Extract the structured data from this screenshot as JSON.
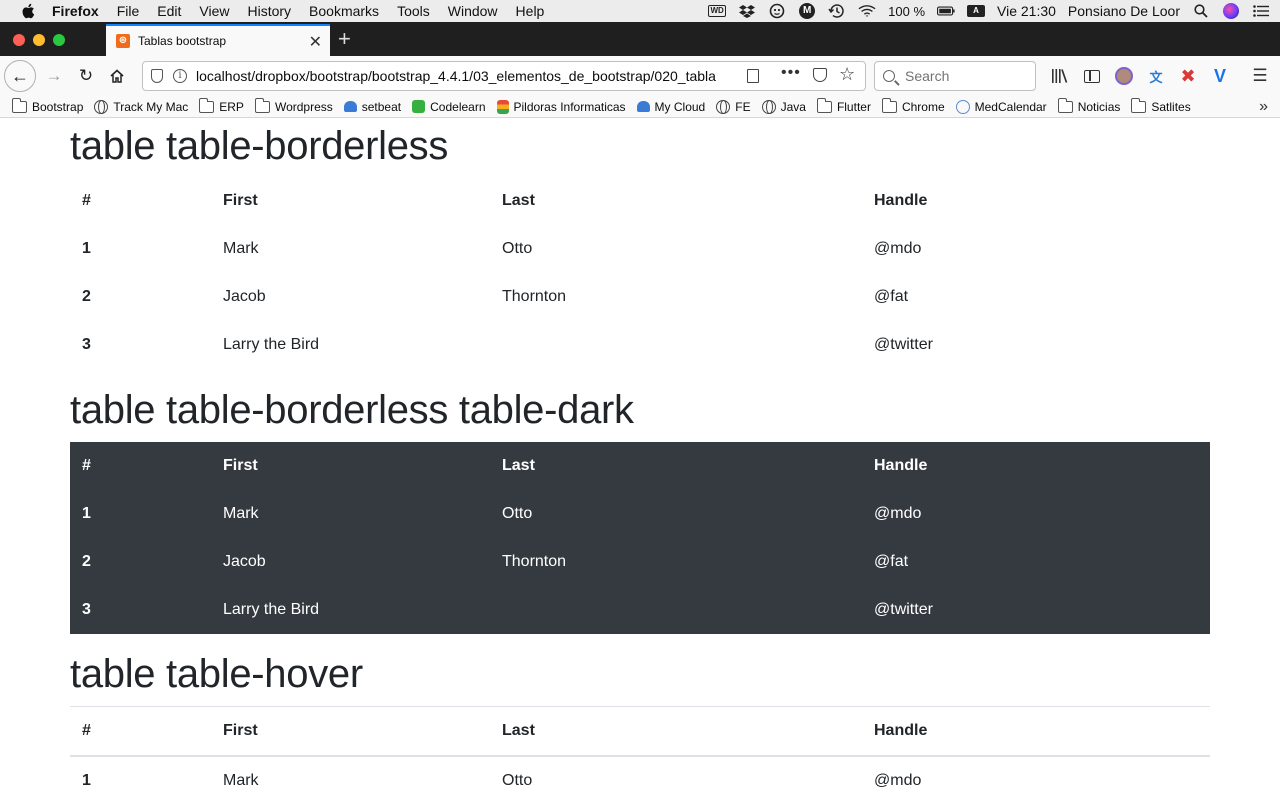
{
  "menubar": {
    "app_name": "Firefox",
    "items": [
      "File",
      "Edit",
      "View",
      "History",
      "Bookmarks",
      "Tools",
      "Window",
      "Help"
    ],
    "battery": "100 %",
    "input_source": "A",
    "clock": "Vie 21:30",
    "user": "Ponsiano De Loor",
    "icons": [
      "wd-icon",
      "dropbox-icon",
      "ghost-icon",
      "m-icon",
      "time-machine-icon",
      "wifi-icon",
      "battery-icon",
      "spotlight-icon",
      "siri-icon",
      "notification-center-icon"
    ]
  },
  "browser": {
    "tab_title": "Tablas bootstrap",
    "url": "localhost/dropbox/bootstrap/bootstrap_4.4.1/03_elementos_de_bootstrap/020_tabla",
    "search_placeholder": "Search",
    "bookmarks": [
      {
        "label": "Bootstrap",
        "icon": "folder"
      },
      {
        "label": "Track My Mac",
        "icon": "globe"
      },
      {
        "label": "ERP",
        "icon": "folder"
      },
      {
        "label": "Wordpress",
        "icon": "folder"
      },
      {
        "label": "setbeat",
        "icon": "blue"
      },
      {
        "label": "Codelearn",
        "icon": "green"
      },
      {
        "label": "Pildoras Informaticas",
        "icon": "stack"
      },
      {
        "label": "My Cloud",
        "icon": "blue"
      },
      {
        "label": "FE",
        "icon": "globe"
      },
      {
        "label": "Java",
        "icon": "globe"
      },
      {
        "label": "Flutter",
        "icon": "folder"
      },
      {
        "label": "Chrome",
        "icon": "folder"
      },
      {
        "label": "MedCalendar",
        "icon": "ui"
      },
      {
        "label": "Noticias",
        "icon": "folder"
      },
      {
        "label": "Satlites",
        "icon": "folder"
      }
    ]
  },
  "page": {
    "sections": [
      {
        "heading": "table table-borderless",
        "headers": [
          "#",
          "First",
          "Last",
          "Handle"
        ],
        "rows": [
          [
            "1",
            "Mark",
            "Otto",
            "@mdo"
          ],
          [
            "2",
            "Jacob",
            "Thornton",
            "@fat"
          ],
          [
            "3",
            "Larry the Bird",
            "",
            "@twitter"
          ]
        ]
      },
      {
        "heading": "table table-borderless table-dark",
        "headers": [
          "#",
          "First",
          "Last",
          "Handle"
        ],
        "rows": [
          [
            "1",
            "Mark",
            "Otto",
            "@mdo"
          ],
          [
            "2",
            "Jacob",
            "Thornton",
            "@fat"
          ],
          [
            "3",
            "Larry the Bird",
            "",
            "@twitter"
          ]
        ]
      },
      {
        "heading": "table table-hover",
        "headers": [
          "#",
          "First",
          "Last",
          "Handle"
        ],
        "rows": [
          [
            "1",
            "Mark",
            "Otto",
            "@mdo"
          ]
        ]
      }
    ]
  },
  "colors": {
    "dark_table_bg": "#343a40",
    "text": "#212529",
    "border": "#dee2e6",
    "tab_accent": "#0a84ff"
  }
}
